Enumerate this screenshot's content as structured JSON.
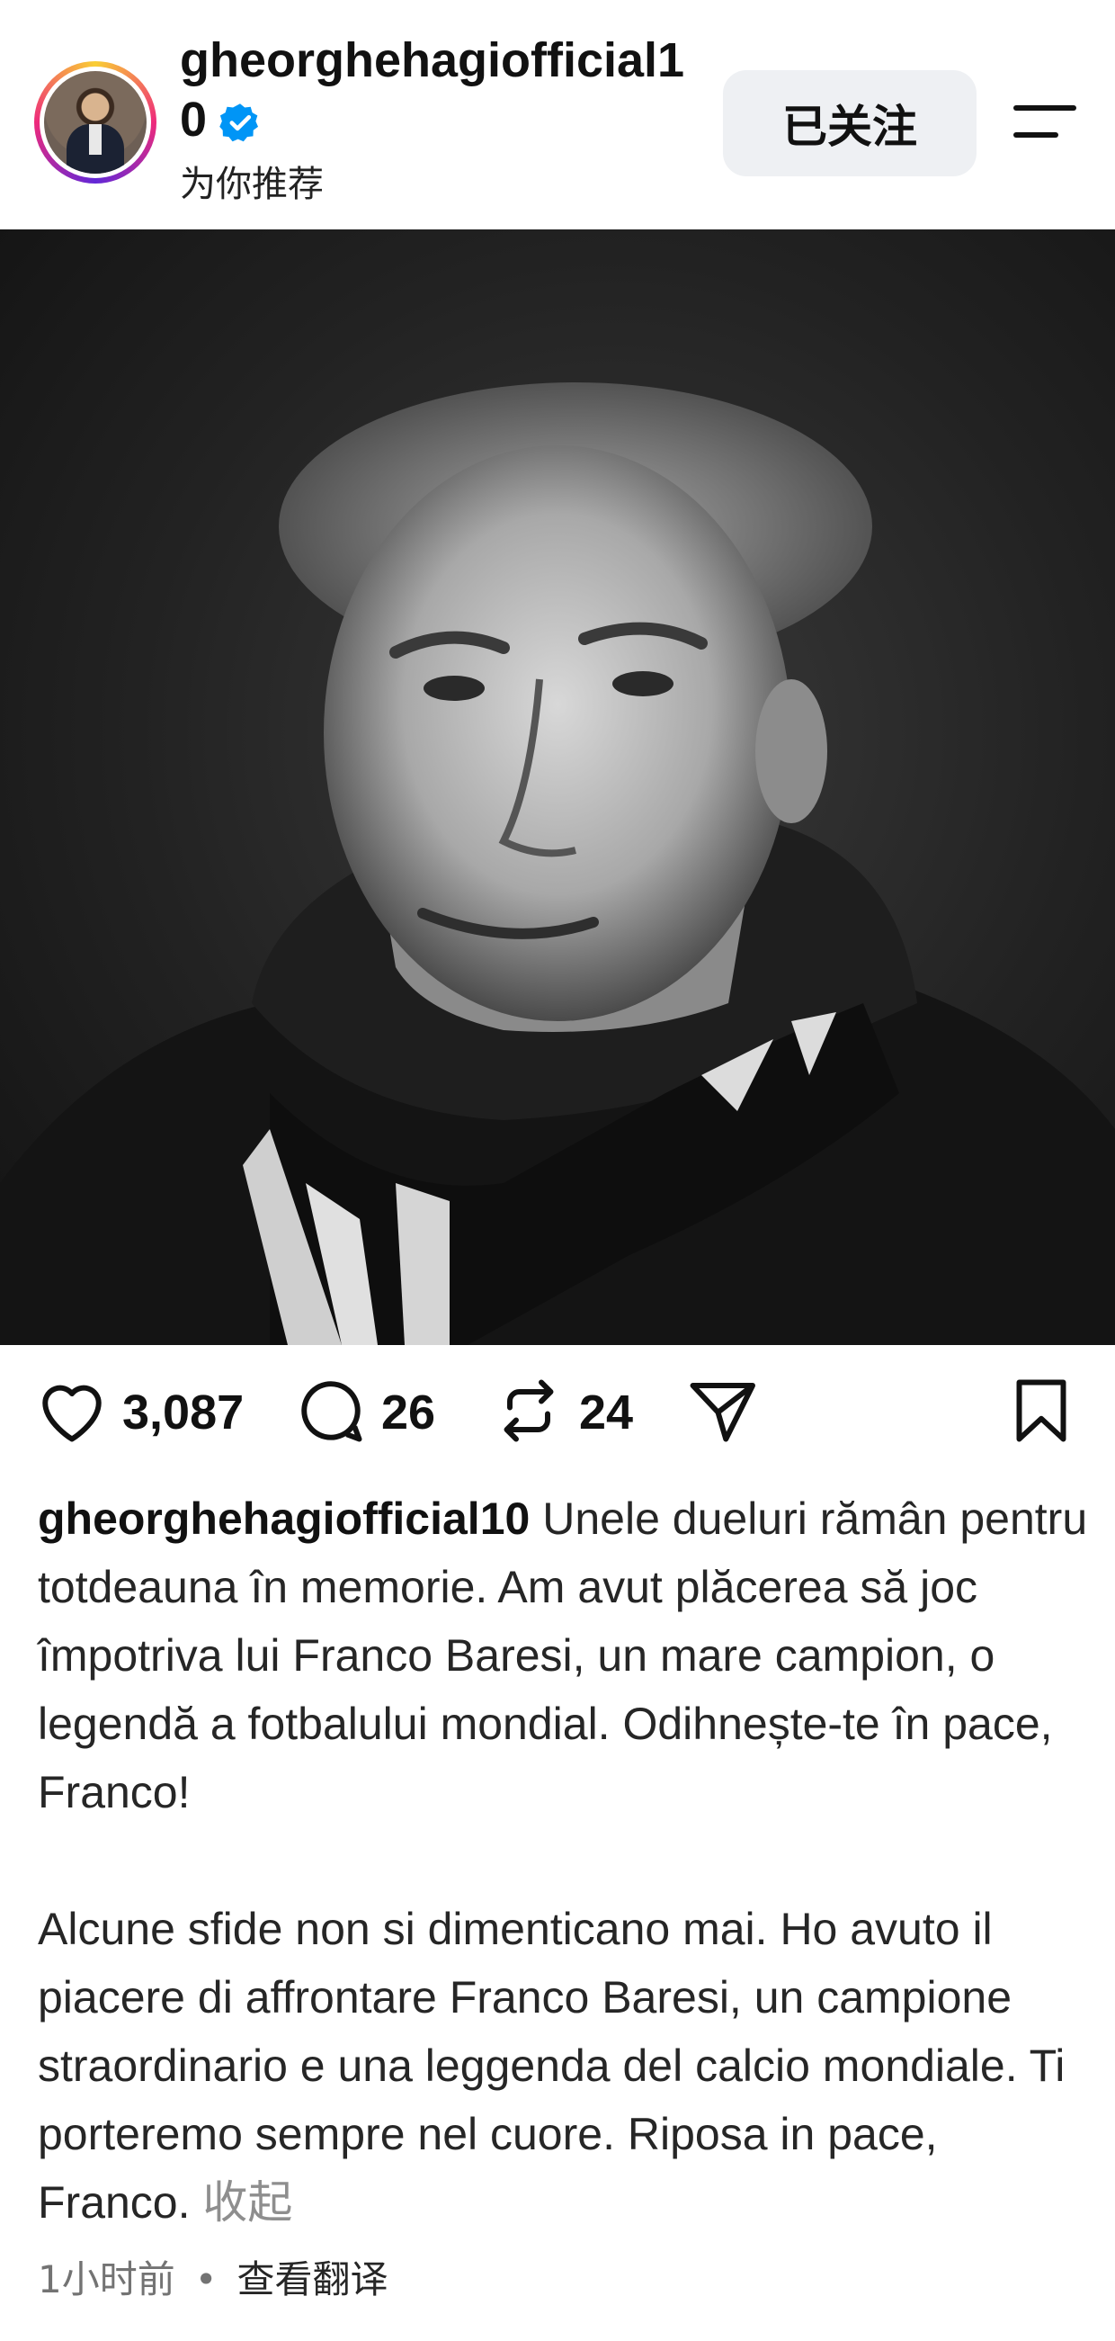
{
  "header": {
    "username": "gheorghehagiofficial10",
    "subtitle": "为你推荐",
    "follow_label": "已关注"
  },
  "actions": {
    "likes": "3,087",
    "comments": "26",
    "reposts": "24"
  },
  "caption": {
    "username": "gheorghehagiofficial10",
    "paragraph1": "Unele dueluri rămân pentru totdeauna în memorie. Am avut plăcerea să joc împotriva lui Franco Baresi, un mare campion, o legendă a fotbalului mondial. Odihnește-te în pace, Franco!",
    "paragraph2": "Alcune sfide non si dimenticano mai. Ho avuto il piacere di affrontare Franco Baresi, un campione straordinario e una leggenda del calcio mondiale. Ti porteremo sempre nel cuore. Riposa in pace, Franco.",
    "collapse_label": "收起"
  },
  "meta": {
    "time": "1小时前",
    "separator": "•",
    "translate_label": "查看翻译"
  },
  "icons": {
    "verified": "verified-badge-icon",
    "menu": "menu-icon",
    "like": "heart-icon",
    "comment": "comment-icon",
    "repost": "repost-icon",
    "share": "send-icon",
    "save": "bookmark-icon"
  },
  "colors": {
    "verified_blue": "#0095f6",
    "follow_bg": "#eef0f3",
    "muted": "#737373"
  }
}
